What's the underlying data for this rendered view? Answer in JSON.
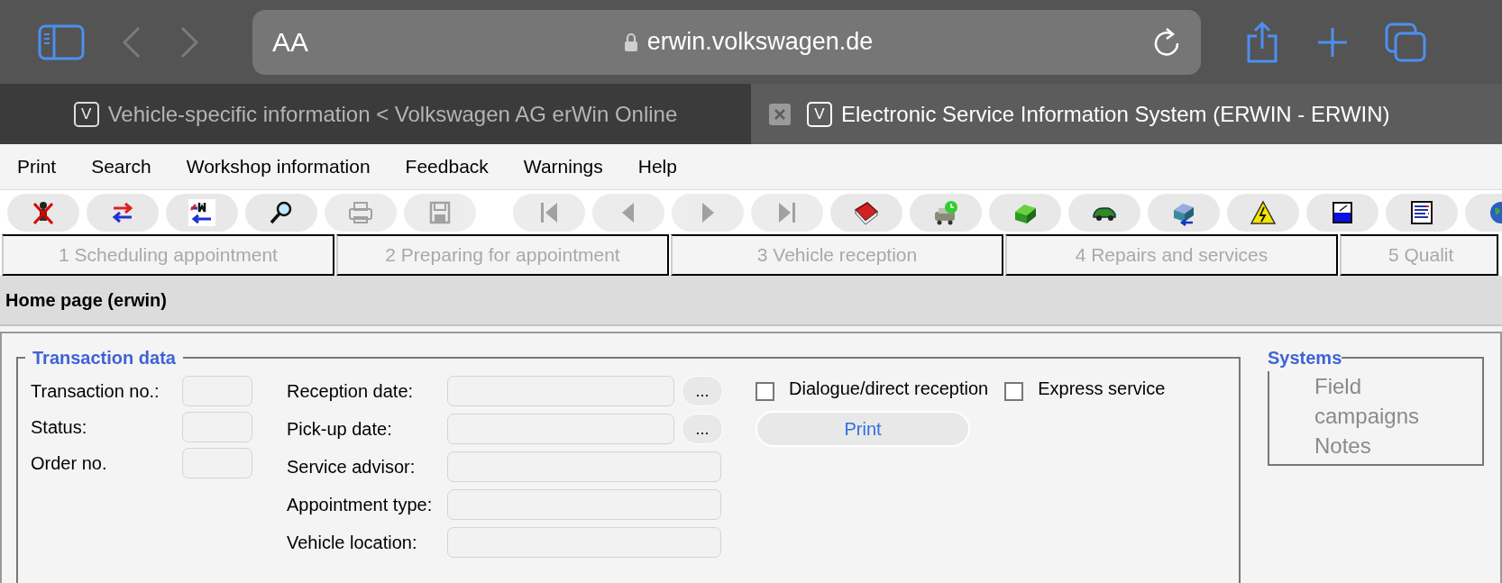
{
  "browser": {
    "text_size_label": "AA",
    "url": "erwin.volkswagen.de",
    "back_disabled": true,
    "forward_disabled": true
  },
  "browser_tabs": [
    {
      "favicon": "V",
      "title": "Vehicle-specific information < Volkswagen AG erWin Online",
      "selected": false
    },
    {
      "favicon": "V",
      "title": "Electronic Service Information System (ERWIN - ERWIN)",
      "selected": true
    }
  ],
  "menu": [
    "Print",
    "Search",
    "Workshop information",
    "Feedback",
    "Warnings",
    "Help"
  ],
  "toolbar": [
    {
      "kind": "exit",
      "disabled": false
    },
    {
      "kind": "swap",
      "disabled": false
    },
    {
      "kind": "swap-m",
      "disabled": false
    },
    {
      "kind": "search",
      "disabled": false
    },
    {
      "kind": "print",
      "disabled": true
    },
    {
      "kind": "save",
      "disabled": true
    },
    {
      "kind": "first",
      "disabled": true
    },
    {
      "kind": "prev",
      "disabled": true
    },
    {
      "kind": "next",
      "disabled": true
    },
    {
      "kind": "last",
      "disabled": true
    },
    {
      "kind": "book",
      "disabled": false
    },
    {
      "kind": "car-clock",
      "disabled": false
    },
    {
      "kind": "block",
      "disabled": false
    },
    {
      "kind": "car",
      "disabled": false
    },
    {
      "kind": "block-arrow",
      "disabled": false
    },
    {
      "kind": "warning",
      "disabled": false
    },
    {
      "kind": "gauge",
      "disabled": false
    },
    {
      "kind": "list",
      "disabled": false
    },
    {
      "kind": "globe",
      "disabled": false
    }
  ],
  "steps": [
    {
      "label": "1 Scheduling appointment",
      "disabled": true
    },
    {
      "label": "2 Preparing for appointment",
      "disabled": true
    },
    {
      "label": "3 Vehicle reception",
      "disabled": true
    },
    {
      "label": "4 Repairs and services",
      "disabled": true
    },
    {
      "label": "5 Qualit",
      "disabled": true
    }
  ],
  "page_title": "Home page (erwin)",
  "transaction": {
    "title": "Transaction data",
    "left_fields": [
      {
        "label": "Transaction no.:"
      },
      {
        "label": "Status:"
      },
      {
        "label": "Order no."
      }
    ],
    "right_fields": [
      {
        "label": "Reception date:",
        "picker": "..."
      },
      {
        "label": "Pick-up date:",
        "picker": "..."
      },
      {
        "label": "Service advisor:"
      },
      {
        "label": "Appointment type:"
      },
      {
        "label": "Vehicle location:"
      }
    ],
    "checkboxes": [
      {
        "label": "Dialogue/direct reception",
        "checked": false
      },
      {
        "label": "Express service",
        "checked": false
      }
    ],
    "print_button": "Print"
  },
  "systems": {
    "title": "Systems",
    "items": [
      {
        "label": "Field campaigns",
        "disabled": true
      },
      {
        "label": "Notes",
        "disabled": true
      }
    ]
  }
}
